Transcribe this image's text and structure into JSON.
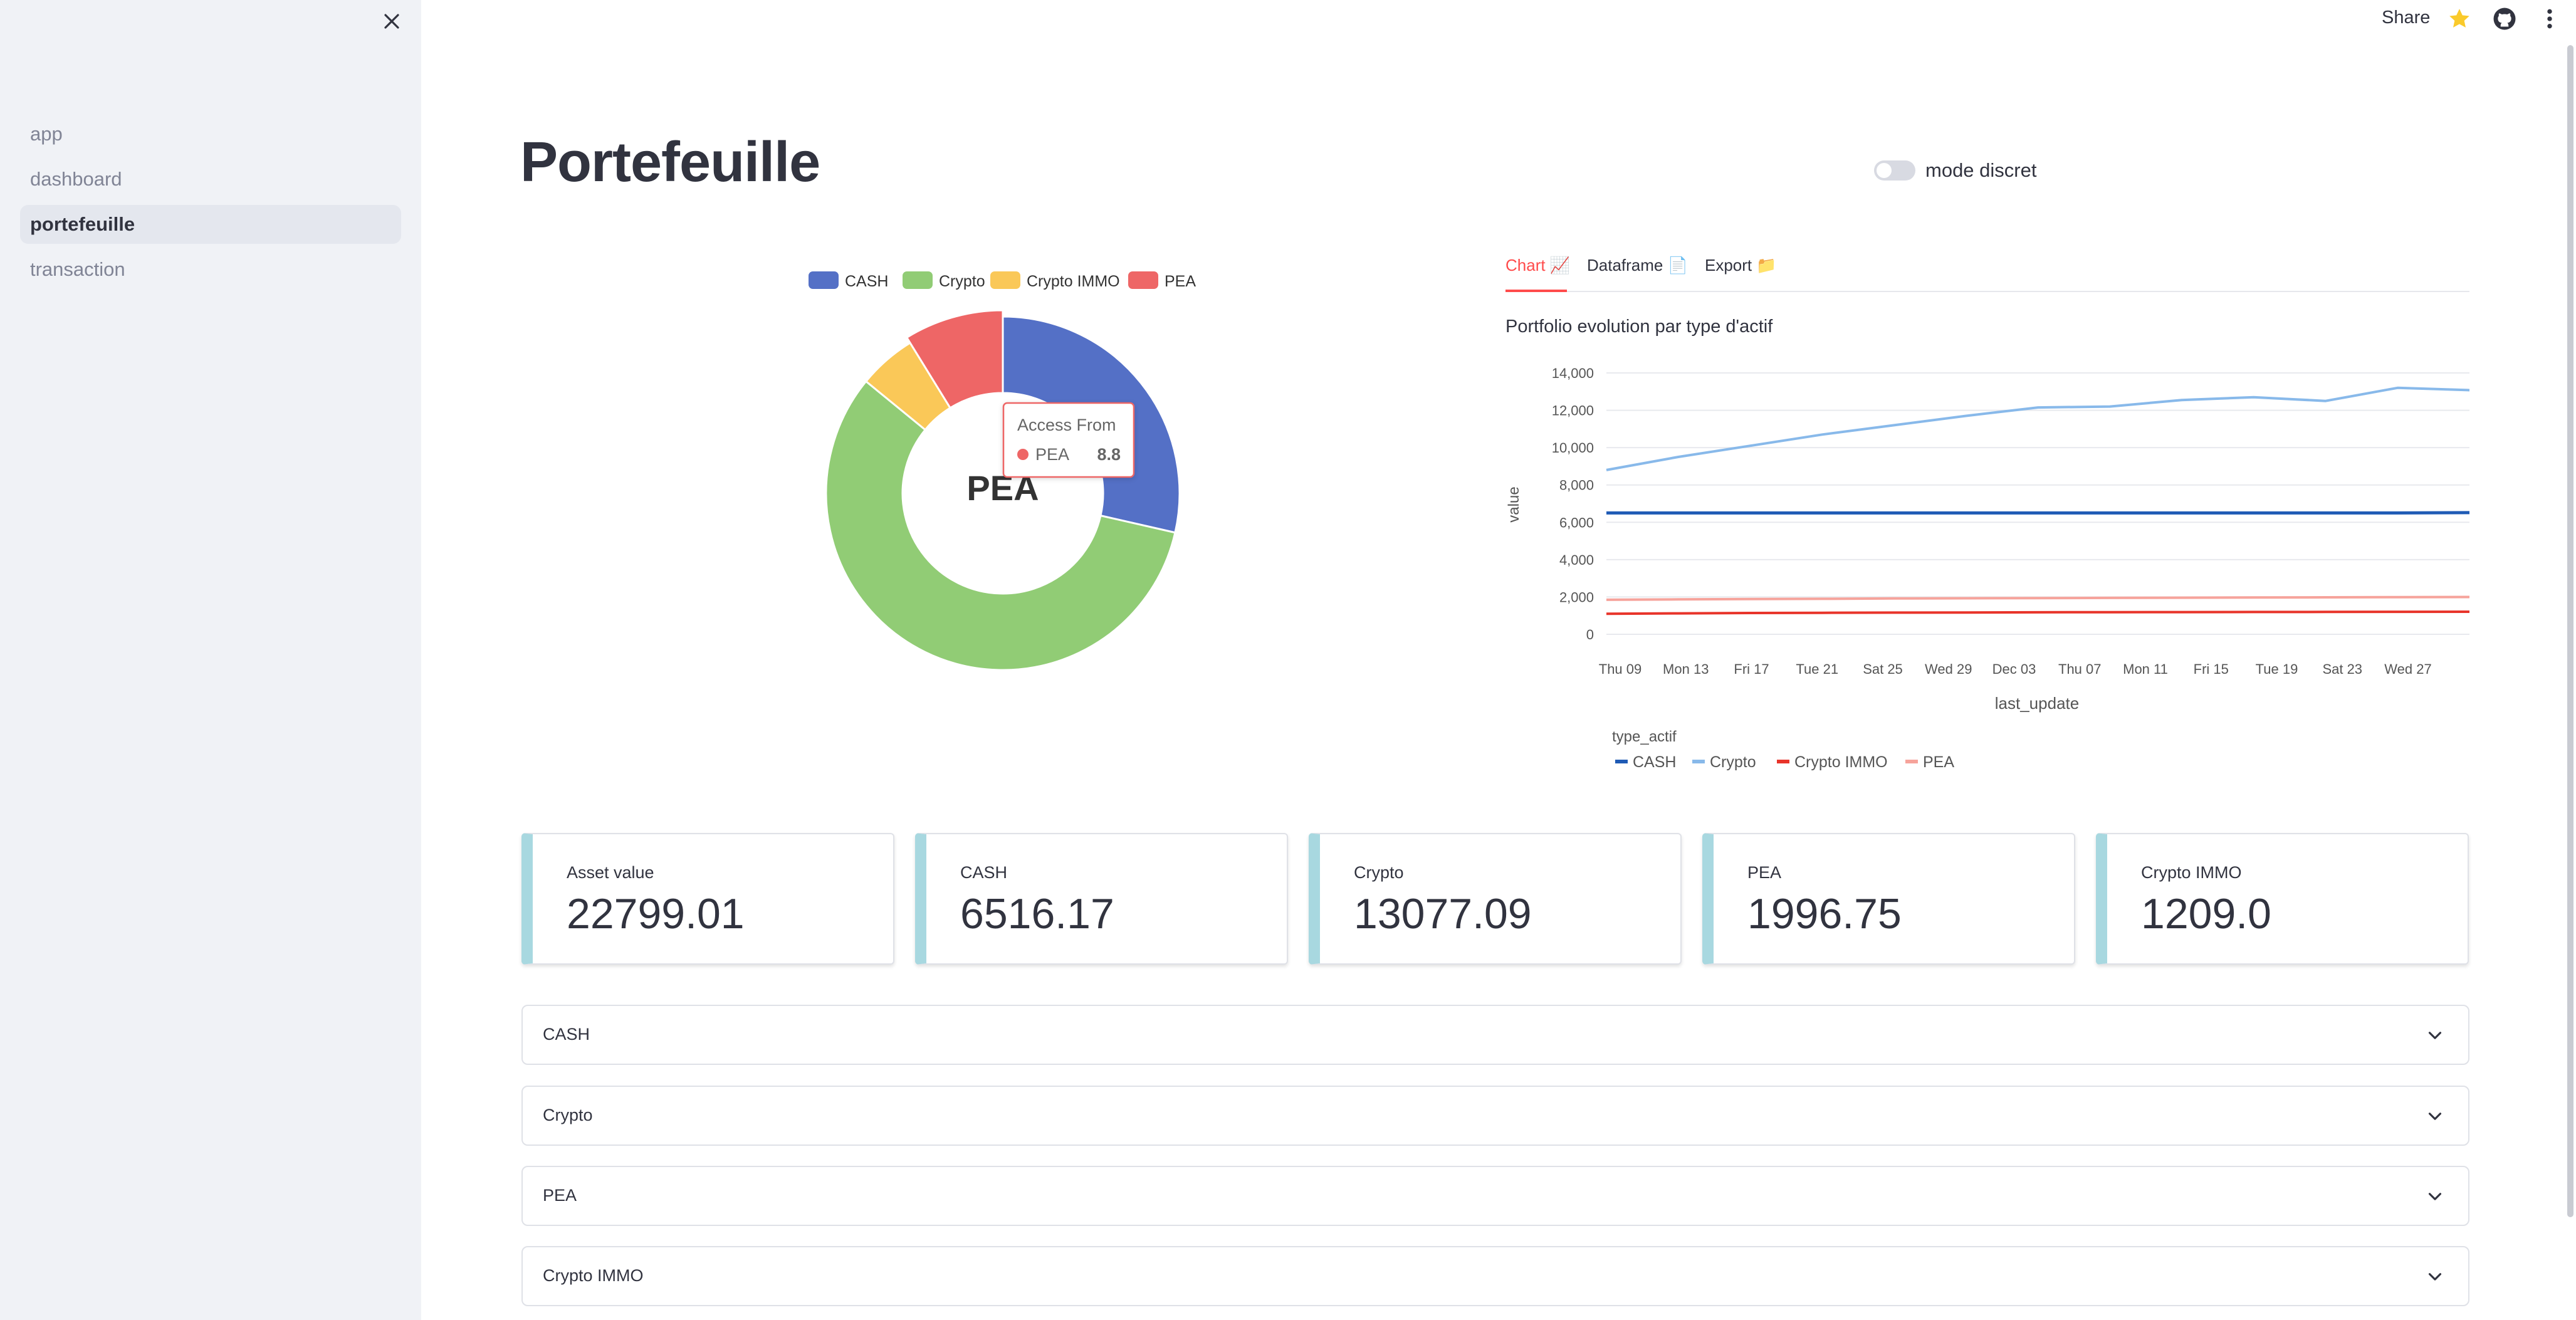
{
  "sidebar": {
    "items": [
      {
        "label": "app",
        "active": false
      },
      {
        "label": "dashboard",
        "active": false
      },
      {
        "label": "portefeuille",
        "active": true
      },
      {
        "label": "transaction",
        "active": false
      }
    ],
    "close_icon": "close-icon"
  },
  "header": {
    "share_label": "Share",
    "star_icon": "star-icon",
    "github_icon": "github-icon",
    "menu_icon": "kebab-menu-icon",
    "star_color": "#faca2b"
  },
  "page": {
    "title": "Portefeuille",
    "toggle_label": "mode discret",
    "toggle_on": false
  },
  "donut": {
    "legend": [
      "CASH",
      "Crypto",
      "Crypto IMMO",
      "PEA"
    ],
    "center_label": "PEA",
    "tooltip": {
      "title": "Access From",
      "series": "PEA",
      "value": "8.8"
    },
    "colors": {
      "CASH": "#5470c6",
      "Crypto": "#91cc75",
      "Crypto IMMO": "#fac858",
      "PEA": "#ee6666"
    }
  },
  "tabs": [
    {
      "label": "Chart 📈",
      "active": true
    },
    {
      "label": "Dataframe 📄",
      "active": false
    },
    {
      "label": "Export 📁",
      "active": false
    }
  ],
  "chart_data": [
    {
      "type": "pie",
      "categories": [
        "CASH",
        "Crypto",
        "Crypto IMMO",
        "PEA"
      ],
      "values": [
        28.6,
        57.4,
        5.3,
        8.8
      ]
    },
    {
      "type": "line",
      "title": "Portfolio evolution par type d'actif",
      "xlabel": "last_update",
      "ylabel": "value",
      "x_ticks": [
        "Thu 09",
        "Mon 13",
        "Fri 17",
        "Tue 21",
        "Sat 25",
        "Wed 29",
        "Dec 03",
        "Thu 07",
        "Mon 11",
        "Fri 15",
        "Tue 19",
        "Sat 23",
        "Wed 27"
      ],
      "y_ticks": [
        "14,000",
        "12,000",
        "10,000",
        "8,000",
        "6,000",
        "4,000",
        "2,000",
        "0"
      ],
      "ylim": [
        0,
        14000
      ],
      "legend_title": "type_actif",
      "grid": true,
      "series": [
        {
          "name": "CASH",
          "color": "#1f5bb5",
          "values": [
            6500,
            6500,
            6500,
            6500,
            6500,
            6500,
            6500,
            6500,
            6500,
            6500,
            6500,
            6500,
            6516
          ]
        },
        {
          "name": "Crypto",
          "color": "#88b9ea",
          "values": [
            8800,
            9500,
            10100,
            10700,
            11200,
            11700,
            12150,
            12200,
            12550,
            12700,
            12500,
            13200,
            13077
          ]
        },
        {
          "name": "Crypto IMMO",
          "color": "#e8342a",
          "values": [
            1100,
            1120,
            1140,
            1150,
            1160,
            1170,
            1180,
            1185,
            1190,
            1195,
            1200,
            1205,
            1209
          ]
        },
        {
          "name": "PEA",
          "color": "#f6a39b",
          "values": [
            1850,
            1870,
            1890,
            1900,
            1920,
            1930,
            1940,
            1950,
            1960,
            1970,
            1980,
            1990,
            1997
          ]
        }
      ]
    }
  ],
  "metrics": [
    {
      "label": "Asset value",
      "value": "22799.01"
    },
    {
      "label": "CASH",
      "value": "6516.17"
    },
    {
      "label": "Crypto",
      "value": "13077.09"
    },
    {
      "label": "PEA",
      "value": "1996.75"
    },
    {
      "label": "Crypto IMMO",
      "value": "1209.0"
    }
  ],
  "expanders": [
    {
      "label": "CASH"
    },
    {
      "label": "Crypto"
    },
    {
      "label": "PEA"
    },
    {
      "label": "Crypto IMMO"
    }
  ]
}
